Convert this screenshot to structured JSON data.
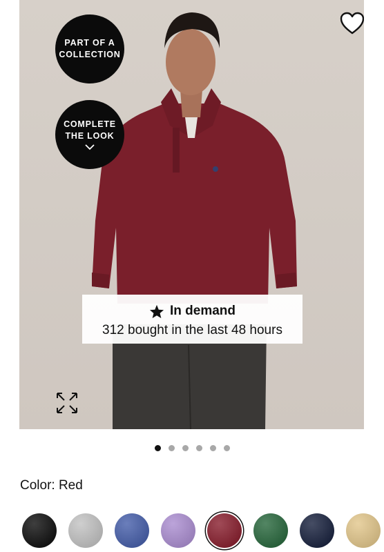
{
  "gallery": {
    "collection_label_line1": "PART OF A",
    "collection_label_line2": "COLLECTION",
    "look_label_line1": "COMPLETE",
    "look_label_line2": "THE LOOK",
    "favorite_icon": "heart-outline-icon",
    "expand_icon": "expand-arrows-icon",
    "demand_title": "In demand",
    "demand_subtitle": "312 bought in the last 48 hours",
    "demand_icon": "star-icon",
    "image_count": 6,
    "active_image_index": 0
  },
  "color": {
    "label": "Color: Red",
    "swatches": [
      {
        "name": "black",
        "hex": "#141414"
      },
      {
        "name": "light-gray",
        "hex": "#c4c4c4"
      },
      {
        "name": "blue",
        "hex": "#4a62ac"
      },
      {
        "name": "lavender",
        "hex": "#ad90d2"
      },
      {
        "name": "red",
        "hex": "#8b2332",
        "selected": true
      },
      {
        "name": "green",
        "hex": "#2d6b41"
      },
      {
        "name": "navy",
        "hex": "#1d2642"
      },
      {
        "name": "tan",
        "hex": "#e3c88e"
      }
    ]
  },
  "colors": {
    "sweater": "#7a1f2b",
    "pants": "#3a3836",
    "background": "#d6cfc8"
  }
}
